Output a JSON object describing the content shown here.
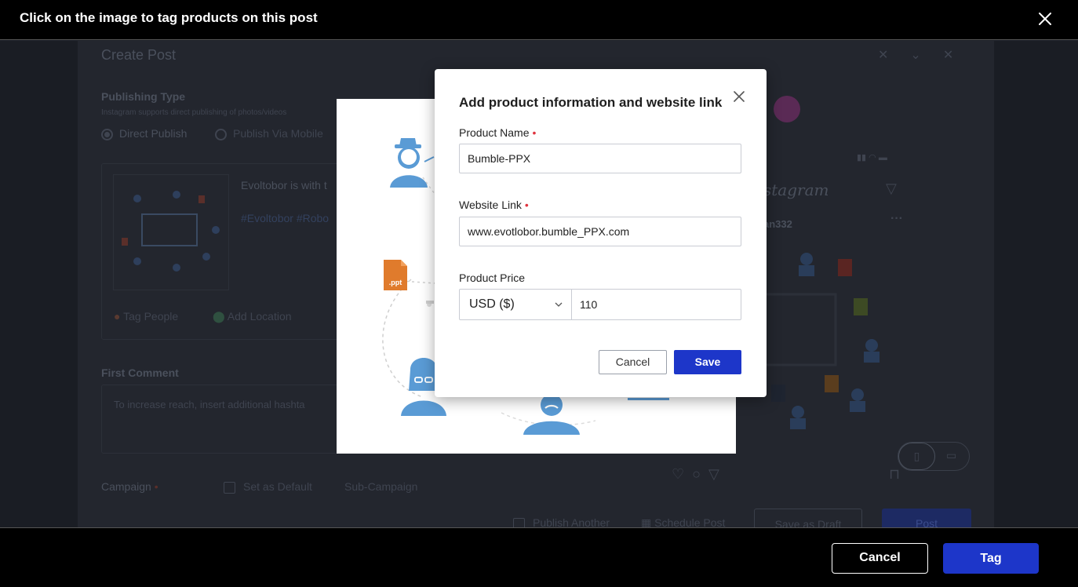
{
  "header": {
    "title": "Click on the image to tag products on this post"
  },
  "background": {
    "title": "Create Post",
    "publishing_type_label": "Publishing Type",
    "publishing_type_desc": "Instagram supports direct publishing of photos/videos",
    "options": [
      "Direct Publish",
      "Publish Via Mobile"
    ],
    "post_text": "Evoltobor is with t",
    "post_tags": "#Evoltobor #Robo",
    "tag_people": "Tag People",
    "add_location": "Add Location",
    "first_comment_label": "First Comment",
    "first_comment_placeholder": "To increase reach, insert additional hashta",
    "campaign_label": "Campaign",
    "set_as_default": "Set as Default",
    "sub_campaign": "Sub-Campaign",
    "publish_another": "Publish Another",
    "schedule_post": "Schedule Post",
    "save_as_draft": "Save as Draft",
    "post_button": "Post",
    "preview_wordmark": "stagram",
    "preview_username": "an332"
  },
  "illustration": {
    "file_label": ".ppt"
  },
  "dialog": {
    "title": "Add product information and website link",
    "product_name_label": "Product Name",
    "product_name_value": "Bumble-PPX",
    "website_link_label": "Website Link",
    "website_link_value": "www.evotlobor.bumble_PPX.com",
    "product_price_label": "Product Price",
    "currency": "USD ($)",
    "price_value": "110",
    "cancel_label": "Cancel",
    "save_label": "Save",
    "required_marker": "•",
    "accent_color": "#1d36c9",
    "required_color": "#e0343f"
  },
  "footer": {
    "cancel_label": "Cancel",
    "tag_label": "Tag"
  }
}
